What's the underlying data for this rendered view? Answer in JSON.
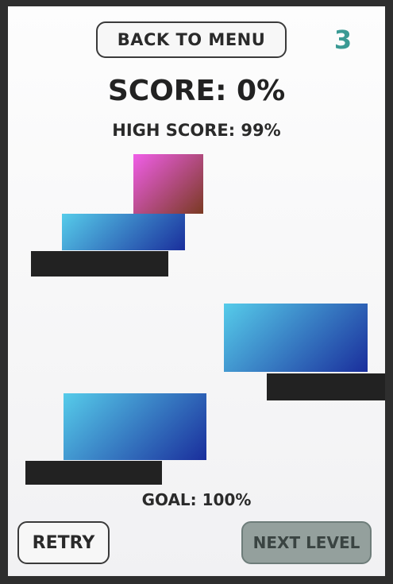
{
  "header": {
    "back_label": "BACK TO MENU",
    "level": "3"
  },
  "score": {
    "label": "SCORE: 0%",
    "high_score_label": "HIGH SCORE: 99%"
  },
  "goal_label": "GOAL: 100%",
  "footer": {
    "retry_label": "RETRY",
    "next_label": "NEXT LEVEL"
  },
  "colors": {
    "level_number": "#3a9a94",
    "block_blue_start": "#56ccea",
    "block_blue_end": "#1a2e9c",
    "block_pink_start": "#f05ee8",
    "block_pink_end": "#7a3a22",
    "platform": "#222222",
    "next_button_disabled": "#94a09d"
  }
}
